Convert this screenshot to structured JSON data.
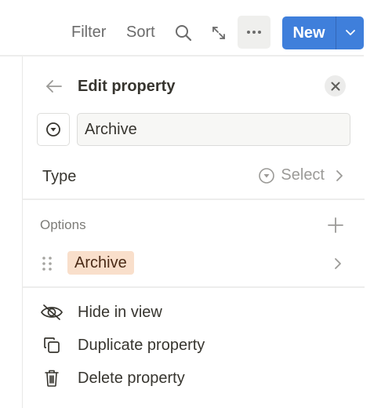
{
  "toolbar": {
    "filter_label": "Filter",
    "sort_label": "Sort",
    "search_icon": "search-icon",
    "expand_icon": "expand-icon",
    "more_icon": "more-horizontal-icon",
    "new_label": "New",
    "new_dropdown_icon": "chevron-down-icon",
    "accent_color": "#3f7fdb"
  },
  "panel": {
    "title": "Edit property",
    "back_icon": "arrow-left-icon",
    "close_icon": "close-icon",
    "property_type_icon": "select-icon",
    "property_name_value": "Archive",
    "type_row": {
      "label": "Type",
      "value": "Select",
      "icon": "select-icon"
    },
    "options": {
      "label": "Options",
      "add_icon": "plus-icon",
      "items": [
        {
          "label": "Archive",
          "color": "#f9dfcb"
        }
      ]
    },
    "actions": [
      {
        "label": "Hide in view",
        "icon": "eye-off-icon"
      },
      {
        "label": "Duplicate property",
        "icon": "duplicate-icon"
      },
      {
        "label": "Delete property",
        "icon": "trash-icon"
      }
    ]
  }
}
